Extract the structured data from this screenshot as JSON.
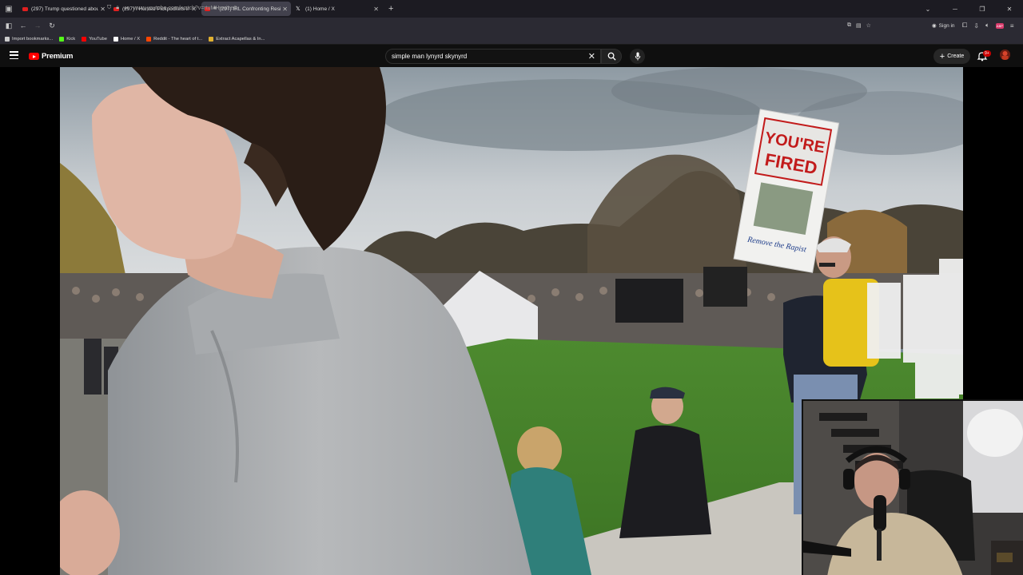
{
  "browser": {
    "tabs": [
      {
        "title": "(297) Trump questioned about",
        "active": false,
        "playing": false,
        "favicon": "youtube-icon"
      },
      {
        "title": "(297) I Hunted Pickpockets in V",
        "active": false,
        "playing": false,
        "favicon": "youtube-icon"
      },
      {
        "title": "(297) IRL Confronting Resis",
        "active": true,
        "playing": true,
        "favicon": "youtube-icon"
      },
      {
        "title": "(1) Home / X",
        "active": false,
        "playing": false,
        "favicon": "x-icon"
      }
    ],
    "url": "www.youtube.com/watch?v=rtuMHwviLe0",
    "sign_in_label": "Sign in",
    "extension_label": "ABP",
    "bookmarks": [
      {
        "label": "Import bookmarks...",
        "icon": "import-icon",
        "color": "#cccccc"
      },
      {
        "label": "Kick",
        "icon": "kick-icon",
        "color": "#53fc18"
      },
      {
        "label": "YouTube",
        "icon": "youtube-icon",
        "color": "#ff0000"
      },
      {
        "label": "Home / X",
        "icon": "x-icon",
        "color": "#ffffff"
      },
      {
        "label": "Reddit - The heart of t...",
        "icon": "reddit-icon",
        "color": "#ff4500"
      },
      {
        "label": "Extract Acapellas & In...",
        "icon": "folder-icon",
        "color": "#e0b030"
      }
    ]
  },
  "youtube": {
    "logo_text": "Premium",
    "search_query": "simple man lynyrd skynyrd",
    "create_label": "Create",
    "notification_count": "9+",
    "brand_color": "#ff0000"
  },
  "video": {
    "sign_text_line1": "YOU'RE",
    "sign_text_line2": "FIRED",
    "sign_caption": "Remove the Rapist"
  }
}
